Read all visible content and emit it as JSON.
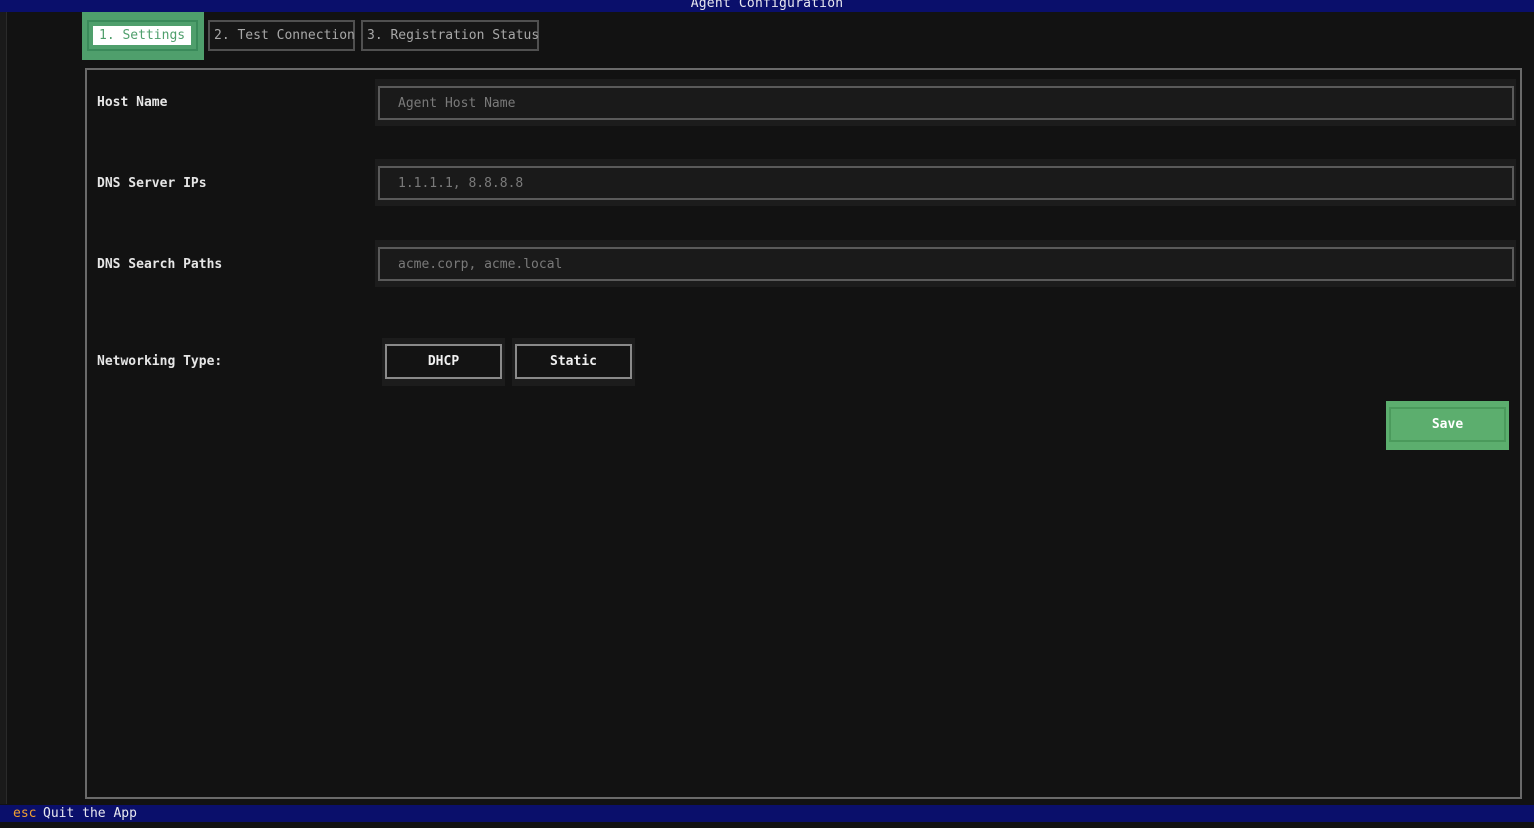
{
  "window": {
    "title": "Agent Configuration"
  },
  "tabs": [
    {
      "label": "1. Settings",
      "active": true
    },
    {
      "label": "2. Test Connection",
      "active": false
    },
    {
      "label": "3. Registration Status",
      "active": false
    }
  ],
  "form": {
    "host_name": {
      "label": "Host Name",
      "value": "",
      "placeholder": "Agent Host Name"
    },
    "dns_servers": {
      "label": "DNS Server IPs",
      "value": "",
      "placeholder": "1.1.1.1, 8.8.8.8"
    },
    "dns_search": {
      "label": "DNS Search Paths",
      "value": "",
      "placeholder": "acme.corp, acme.local"
    },
    "networking": {
      "label": "Networking Type:",
      "options": [
        "DHCP",
        "Static"
      ]
    },
    "save_label": "Save"
  },
  "footer": {
    "key": "esc",
    "description": "Quit the App"
  },
  "colors": {
    "title_bar": "#0a0f6b",
    "accent_green": "#5cae6e",
    "tab_active": "#4f9f6c",
    "footer_key": "#f0a030",
    "background": "#121212"
  }
}
